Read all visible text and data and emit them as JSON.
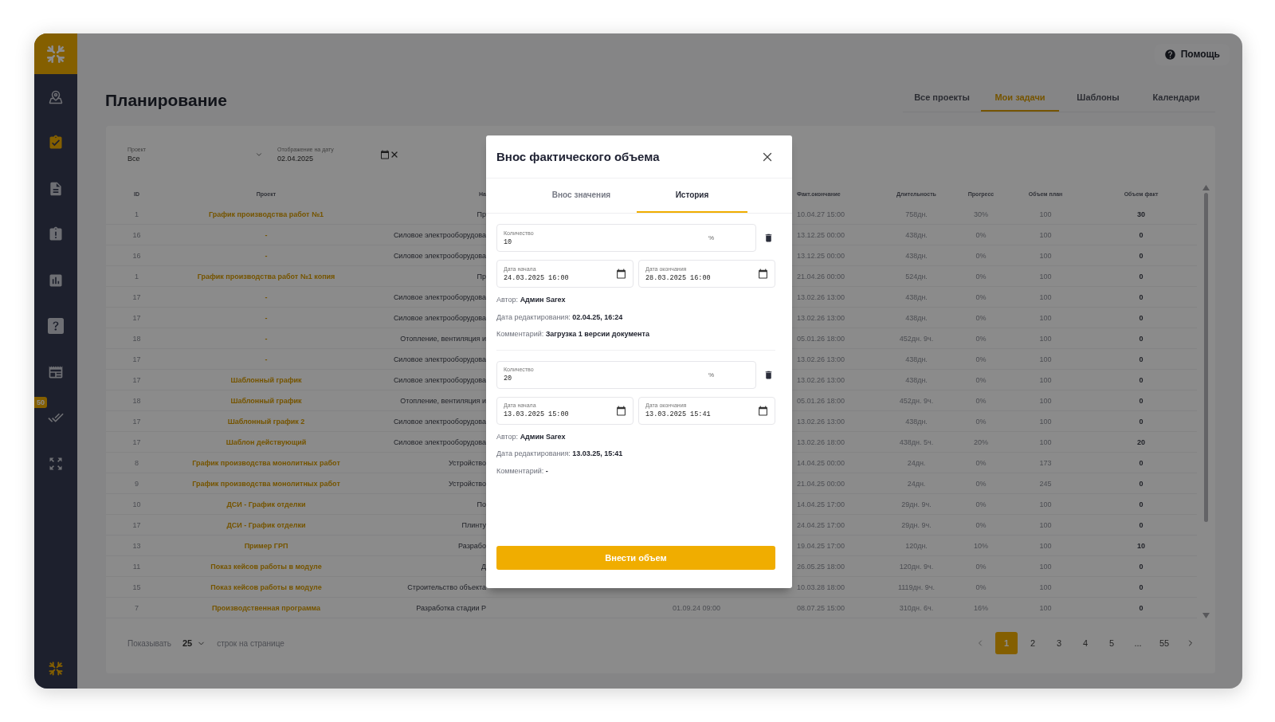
{
  "sidebar": {
    "items": [
      {
        "selected": false
      },
      {
        "selected": true
      },
      {
        "selected": false
      },
      {
        "selected": false
      },
      {
        "selected": false
      },
      {
        "selected": false
      },
      {
        "selected": false
      },
      {
        "selected": false,
        "badge": "50"
      },
      {
        "selected": false
      }
    ]
  },
  "header": {
    "help": "Помощь"
  },
  "page": {
    "title": "Планирование",
    "tabs": [
      {
        "label": "Все проекты",
        "selected": false
      },
      {
        "label": "Мои задачи",
        "selected": true
      },
      {
        "label": "Шаблоны",
        "selected": false
      },
      {
        "label": "Календари",
        "selected": false
      }
    ]
  },
  "filters": [
    {
      "kind": "select",
      "label": "Проект",
      "value": "Все"
    },
    {
      "kind": "date",
      "label": "Отображение на дату",
      "value": "02.04.2025"
    }
  ],
  "table": {
    "columns": [
      "ID",
      "Проект",
      "На",
      "Факт.окончание",
      "Длительность",
      "Прогресс",
      "Объем план",
      "Объем факт"
    ],
    "rows": [
      {
        "id": "1",
        "project": "График производства работ №1",
        "name": "Пр",
        "end": "10.04.27 15:00",
        "duration": "758дн.",
        "progress": "30%",
        "plan": "100",
        "fact": "30"
      },
      {
        "id": "16",
        "project": "-",
        "name": "Силовое электрооборудова",
        "end": "13.12.25 00:00",
        "duration": "438дн.",
        "progress": "0%",
        "plan": "100",
        "fact": "0"
      },
      {
        "id": "16",
        "project": "-",
        "name": "Силовое электрооборудова",
        "end": "13.12.25 00:00",
        "duration": "438дн.",
        "progress": "0%",
        "plan": "100",
        "fact": "0"
      },
      {
        "id": "1",
        "project": "График производства работ №1 копия",
        "name": "Пр",
        "end": "21.04.26 00:00",
        "duration": "524дн.",
        "progress": "0%",
        "plan": "100",
        "fact": "0"
      },
      {
        "id": "17",
        "project": "-",
        "name": "Силовое электрооборудова",
        "end": "13.02.26 13:00",
        "duration": "438дн.",
        "progress": "0%",
        "plan": "100",
        "fact": "0"
      },
      {
        "id": "17",
        "project": "-",
        "name": "Силовое электрооборудова",
        "end": "13.02.26 13:00",
        "duration": "438дн.",
        "progress": "0%",
        "plan": "100",
        "fact": "0"
      },
      {
        "id": "18",
        "project": "-",
        "name": "Отопление, вентиляция и",
        "end": "05.01.26 18:00",
        "duration": "452дн. 9ч.",
        "progress": "0%",
        "plan": "100",
        "fact": "0"
      },
      {
        "id": "17",
        "project": "-",
        "name": "Силовое электрооборудова",
        "end": "13.02.26 13:00",
        "duration": "438дн.",
        "progress": "0%",
        "plan": "100",
        "fact": "0"
      },
      {
        "id": "17",
        "project": "Шаблонный график",
        "name": "Силовое электрооборудова",
        "end": "13.02.26 13:00",
        "duration": "438дн.",
        "progress": "0%",
        "plan": "100",
        "fact": "0"
      },
      {
        "id": "18",
        "project": "Шаблонный график",
        "name": "Отопление, вентиляция и",
        "end": "05.01.26 18:00",
        "duration": "452дн. 9ч.",
        "progress": "0%",
        "plan": "100",
        "fact": "0"
      },
      {
        "id": "17",
        "project": "Шаблонный график 2",
        "name": "Силовое электрооборудова",
        "end": "13.02.26 13:00",
        "duration": "438дн.",
        "progress": "0%",
        "plan": "100",
        "fact": "0"
      },
      {
        "id": "17",
        "project": "Шаблон действующий",
        "name": "Силовое электрооборудова",
        "end": "13.02.26 18:00",
        "duration": "438дн. 5ч.",
        "progress": "20%",
        "plan": "100",
        "fact": "20"
      },
      {
        "id": "8",
        "project": "График производства монолитных работ",
        "name": "Устройство",
        "end": "14.04.25 00:00",
        "duration": "24дн.",
        "progress": "0%",
        "plan": "173",
        "fact": "0"
      },
      {
        "id": "9",
        "project": "График производства монолитных работ",
        "name": "Устройство",
        "end": "21.04.25 00:00",
        "duration": "24дн.",
        "progress": "0%",
        "plan": "245",
        "fact": "0"
      },
      {
        "id": "10",
        "project": "ДСИ - График отделки",
        "name": "По",
        "end": "14.04.25 17:00",
        "duration": "29дн. 9ч.",
        "progress": "0%",
        "plan": "100",
        "fact": "0"
      },
      {
        "id": "17",
        "project": "ДСИ - График отделки",
        "name": "Плинту",
        "end": "24.04.25 17:00",
        "duration": "29дн. 9ч.",
        "progress": "0%",
        "plan": "100",
        "fact": "0"
      },
      {
        "id": "13",
        "project": "Пример ГРП",
        "name": "Разрабо",
        "end": "19.04.25 17:00",
        "duration": "120дн.",
        "progress": "10%",
        "plan": "100",
        "fact": "10"
      },
      {
        "id": "11",
        "project": "Показ кейсов работы в модуле",
        "name": "Д",
        "end": "26.05.25 18:00",
        "duration": "120дн. 9ч.",
        "progress": "0%",
        "plan": "100",
        "fact": "0"
      },
      {
        "id": "15",
        "project": "Показ кейсов работы в модуле",
        "name": "Строительство объекта",
        "end": "10.03.28 18:00",
        "duration": "1119дн. 9ч.",
        "progress": "0%",
        "plan": "100",
        "fact": "0"
      },
      {
        "id": "7",
        "project": "Производственная программа",
        "name": "Разработка стадии Р",
        "start": "01.09.24 09:00",
        "end": "08.07.25 15:00",
        "duration": "310дн. 6ч.",
        "progress": "16%",
        "plan": "100",
        "fact": "0"
      }
    ]
  },
  "pagination": {
    "show_label": "Показывать",
    "per_page": "25",
    "per_page_label": "строк на странице",
    "pages": [
      {
        "label": "1",
        "selected": true
      },
      {
        "label": "2",
        "selected": false
      },
      {
        "label": "3",
        "selected": false
      },
      {
        "label": "4",
        "selected": false
      },
      {
        "label": "5",
        "selected": false
      },
      {
        "label": "...",
        "selected": false
      },
      {
        "label": "55",
        "selected": false
      }
    ]
  },
  "modal": {
    "title": "Внос фактического объема",
    "tabs": [
      {
        "label": "Внос значения",
        "selected": false
      },
      {
        "label": "История",
        "selected": true
      }
    ],
    "entries": [
      {
        "quantity_label": "Количество",
        "quantity": "10",
        "unit": "%",
        "start_label": "Дата начала",
        "start": "24.03.2025 16:00",
        "end_label": "Дата окончания",
        "end": "28.03.2025 16:00",
        "author": "Автор: **Админ Sarex**",
        "edited": "Дата редактирования: **02.04.25, 16:24**",
        "comment": "Комментарий: **Загрузка 1 версии документа**"
      },
      {
        "quantity_label": "Количество",
        "quantity": "20",
        "unit": "%",
        "start_label": "Дата начала",
        "start": "13.03.2025 15:00",
        "end_label": "Дата окончания",
        "end": "13.03.2025 15:41",
        "author": "Автор: **Админ Sarex**",
        "edited": "Дата редактирования: **13.03.25, 15:41**",
        "comment": "Комментарий: **-**"
      }
    ],
    "submit": "Внести объем"
  }
}
